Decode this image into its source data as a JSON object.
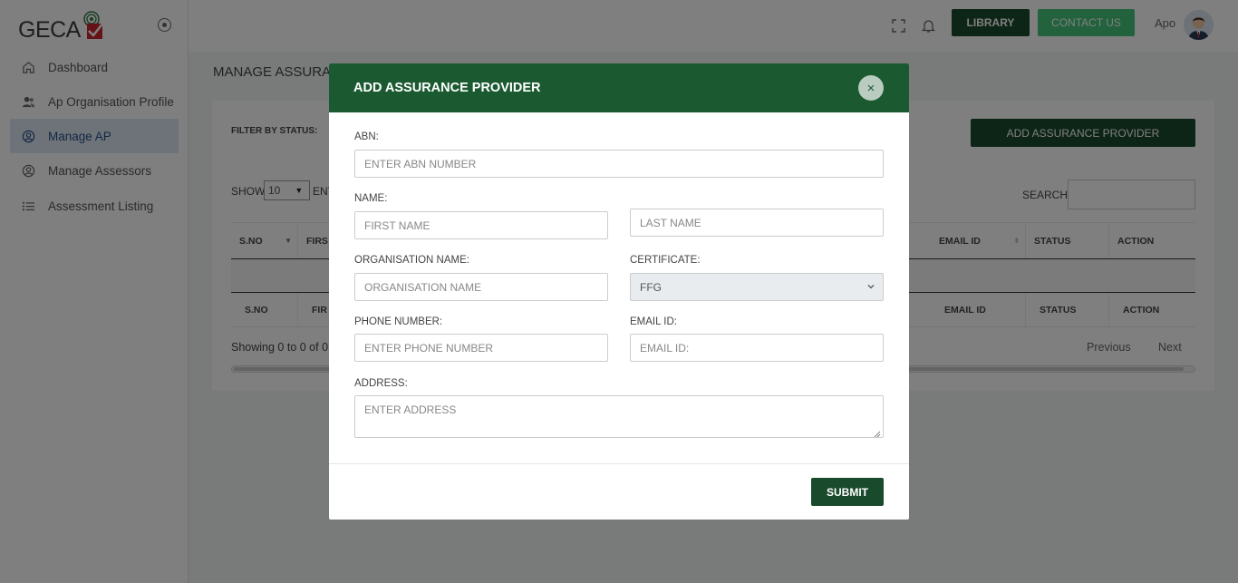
{
  "brand": {
    "name": "GECA"
  },
  "sidebar": {
    "items": [
      {
        "label": "Dashboard",
        "icon": "home-icon"
      },
      {
        "label": "Ap Organisation Profile",
        "icon": "users-icon"
      },
      {
        "label": "Manage AP",
        "icon": "user-circle-icon",
        "active": true
      },
      {
        "label": "Manage Assessors",
        "icon": "user-circle-icon"
      },
      {
        "label": "Assessment Listing",
        "icon": "list-icon"
      }
    ]
  },
  "header": {
    "library_label": "LIBRARY",
    "contact_label": "CONTACT US",
    "user_name": "Apo"
  },
  "page": {
    "title": "MANAGE ASSURA",
    "filter_label": "FILTER BY STATUS:",
    "add_button": "ADD ASSURANCE PROVIDER",
    "show_label": "SHOW",
    "show_value": "10",
    "entries_label": "ENT",
    "search_label": "SEARCH:",
    "table": {
      "columns": [
        "S.NO",
        "FIRS",
        "EMAIL ID",
        "STATUS",
        "ACTION"
      ],
      "footer_columns": [
        "S.NO",
        "FIR",
        "EMAIL ID",
        "STATUS",
        "ACTION"
      ]
    },
    "showing_text": "Showing 0 to 0 of 0",
    "prev_label": "Previous",
    "next_label": "Next"
  },
  "modal": {
    "title": "ADD ASSURANCE PROVIDER",
    "close_label": "×",
    "abn_label": "ABN:",
    "abn_placeholder": "ENTER ABN NUMBER",
    "name_label": "NAME:",
    "first_name_placeholder": "FIRST NAME",
    "last_name_placeholder": "LAST NAME",
    "org_label": "ORGANISATION NAME:",
    "org_placeholder": "ORGANISATION NAME",
    "certificate_label": "CERTIFICATE:",
    "certificate_value": "FFG",
    "phone_label": "PHONE NUMBER:",
    "phone_placeholder": "ENTER PHONE NUMBER",
    "email_label": "EMAIL ID:",
    "email_placeholder": "EMAIL ID:",
    "address_label": "ADDRESS:",
    "address_placeholder": "ENTER ADDRESS",
    "submit_label": "SUBMIT"
  },
  "colors": {
    "primary_dark": "#1a4a2c",
    "modal_header": "#1b5a31",
    "contact_green": "#45c47a",
    "active_nav_bg": "#dde7f3"
  }
}
